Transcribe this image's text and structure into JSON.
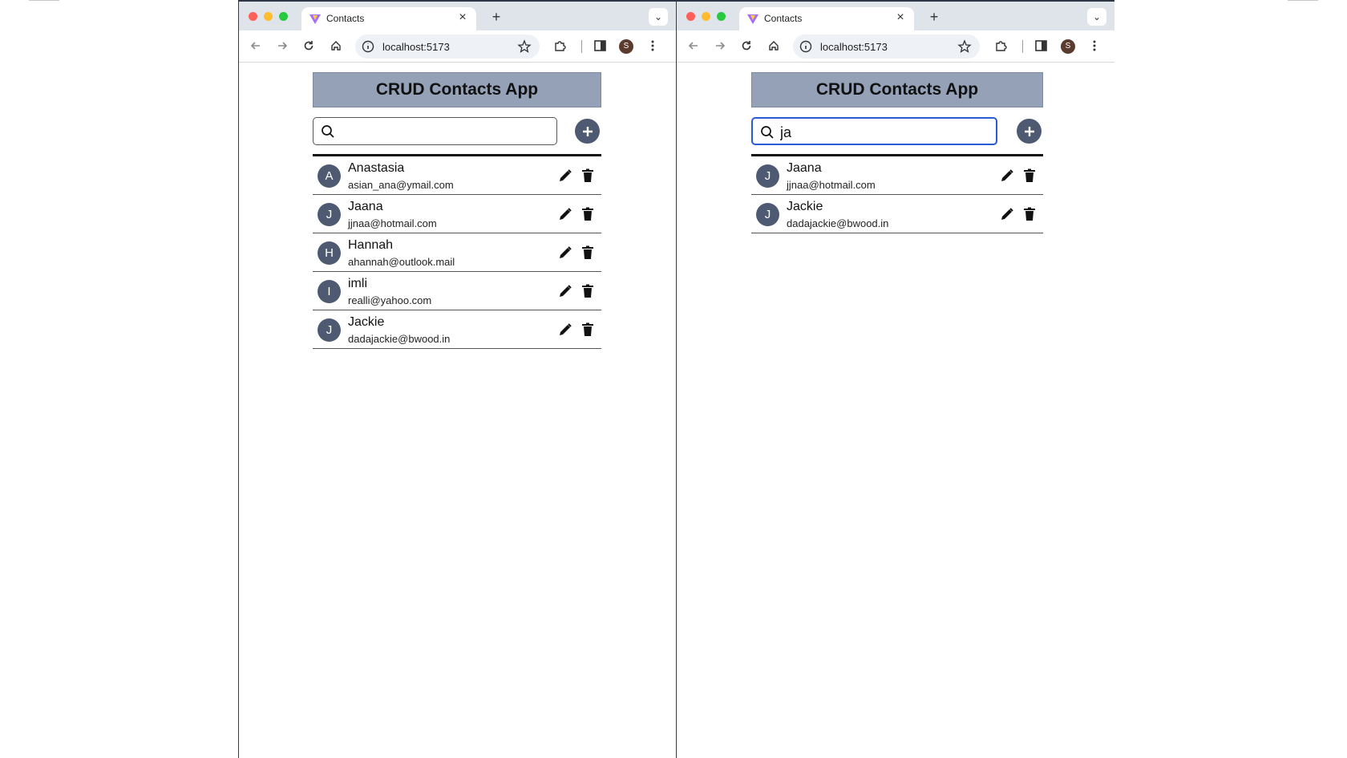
{
  "windows": [
    {
      "tab": {
        "title": "Contacts",
        "close": "×",
        "new_tab": "+",
        "menu": "⌄"
      },
      "address": {
        "url": "localhost:5173"
      },
      "profile_initial": "S",
      "app": {
        "title": "CRUD Contacts App",
        "search": {
          "value": "",
          "placeholder": "",
          "focused": false
        },
        "add_label": "+",
        "contacts": [
          {
            "initial": "A",
            "name": "Anastasia",
            "email": "asian_ana@ymail.com"
          },
          {
            "initial": "J",
            "name": "Jaana",
            "email": "jjnaa@hotmail.com"
          },
          {
            "initial": "H",
            "name": "Hannah",
            "email": "ahannah@outlook.mail"
          },
          {
            "initial": "I",
            "name": "imli",
            "email": "realli@yahoo.com"
          },
          {
            "initial": "J",
            "name": "Jackie",
            "email": "dadajackie@bwood.in"
          }
        ]
      }
    },
    {
      "tab": {
        "title": "Contacts",
        "close": "×",
        "new_tab": "+",
        "menu": "⌄"
      },
      "address": {
        "url": "localhost:5173"
      },
      "profile_initial": "S",
      "app": {
        "title": "CRUD Contacts App",
        "search": {
          "value": "ja",
          "placeholder": "",
          "focused": true
        },
        "add_label": "+",
        "contacts": [
          {
            "initial": "J",
            "name": "Jaana",
            "email": "jjnaa@hotmail.com"
          },
          {
            "initial": "J",
            "name": "Jackie",
            "email": "dadajackie@bwood.in"
          }
        ]
      }
    }
  ],
  "colors": {
    "header_bg": "#94a1b7",
    "avatar_bg": "#4d5a72",
    "focus_ring": "#2a5bd7",
    "tabbar_bg": "#dfe3ea"
  }
}
